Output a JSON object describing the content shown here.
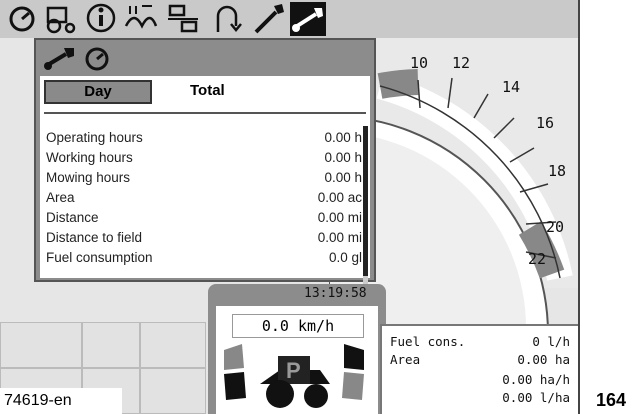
{
  "toolbar": {
    "icons": [
      "gauge-icon",
      "tractor-icon",
      "info-icon",
      "implement-icon",
      "sequence-icon",
      "headland-icon",
      "wrench-icon",
      "wrench-active-icon"
    ]
  },
  "popup": {
    "header_icons": [
      "wrench-icon",
      "gauge-icon"
    ],
    "tabs": {
      "day": "Day",
      "total": "Total"
    },
    "rows": [
      {
        "label": "Operating hours",
        "value": "0.00 h"
      },
      {
        "label": "Working hours",
        "value": "0.00 h"
      },
      {
        "label": "Mowing hours",
        "value": "0.00 h"
      },
      {
        "label": "Area",
        "value": "0.00 ac"
      },
      {
        "label": "Distance",
        "value": "0.00 mi"
      },
      {
        "label": "Distance to field",
        "value": "0.00 mi"
      },
      {
        "label": "Fuel consumption",
        "value": "0.0 gl"
      }
    ]
  },
  "gauge": {
    "ticks": [
      "10",
      "12",
      "14",
      "16",
      "18",
      "20",
      "22"
    ]
  },
  "clock": {
    "time": "13:19:58"
  },
  "speed": {
    "value": "0.0 km/h"
  },
  "gear": {
    "label": "P"
  },
  "fuel_panel": {
    "fuel_label": "Fuel cons.",
    "fuel_value": "0 l/h",
    "area_label": "Area",
    "area_value": "0.00 ha",
    "rate_value": "0.00 ha/h",
    "rate2_value": "0.00 l/ha"
  },
  "caption": "74619-en",
  "page_number": "164"
}
